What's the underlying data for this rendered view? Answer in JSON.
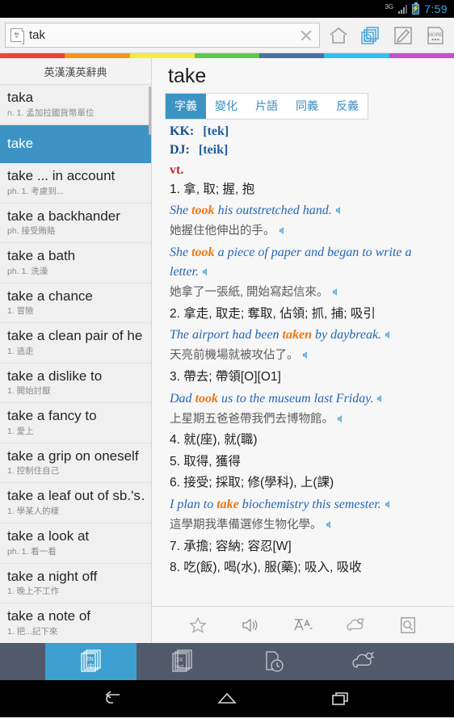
{
  "status_bar": {
    "network": "3G",
    "time": "7:59",
    "time_color": "#38a8dd",
    "battery_icon": "battery-charging-icon",
    "signal_icon": "signal-bars-icon"
  },
  "toolbar": {
    "search": {
      "value": "tak",
      "placeholder": "",
      "icon": "dictionary-book-icon",
      "clear_icon": "clear-x-icon"
    },
    "actions": [
      {
        "name": "home-button",
        "icon": "home-icon",
        "label": "Home",
        "active": false
      },
      {
        "name": "media-cards-button",
        "icon": "media-stack-icon",
        "label": "Media",
        "active": true
      },
      {
        "name": "notes-button",
        "icon": "pencil-edit-icon",
        "label": "Notes",
        "active": false
      },
      {
        "name": "more-button",
        "icon": "more-page-icon",
        "label": "MORE",
        "active": false
      }
    ]
  },
  "rainbow_colors": [
    "#ef4136",
    "#f7941e",
    "#f6ec3c",
    "#5cc94c",
    "#4a6fa5",
    "#31c0ef",
    "#c44fd0"
  ],
  "sidebar": {
    "title": "英漢漢英辭典",
    "entries": [
      {
        "headword": "taka",
        "sub": "n. 1. 孟加拉國貨幣單位",
        "selected": false
      },
      {
        "headword": "take",
        "sub": "",
        "selected": true
      },
      {
        "headword": "take ... in account",
        "sub": "ph. 1. 考慮到...",
        "selected": false
      },
      {
        "headword": "take a backhander",
        "sub": "ph. 接受賄賂",
        "selected": false
      },
      {
        "headword": "take a bath",
        "sub": "ph. 1. 洗澡",
        "selected": false
      },
      {
        "headword": "take a chance",
        "sub": "1. 冒險",
        "selected": false
      },
      {
        "headword": "take a clean pair of he…",
        "sub": "1. 逃走",
        "selected": false
      },
      {
        "headword": "take a dislike to",
        "sub": "1. 開始討厭",
        "selected": false
      },
      {
        "headword": "take a fancy to",
        "sub": "1. 愛上",
        "selected": false
      },
      {
        "headword": "take a grip on oneself",
        "sub": "1. 控制住自己",
        "selected": false
      },
      {
        "headword": "take a leaf out of sb.'s…",
        "sub": "1. 學某人的樣",
        "selected": false
      },
      {
        "headword": "take a look at",
        "sub": "ph. 1. 看一看",
        "selected": false
      },
      {
        "headword": "take a night off",
        "sub": "1. 晚上不工作",
        "selected": false
      },
      {
        "headword": "take a note of",
        "sub": "1. 把...記下來",
        "selected": false
      }
    ],
    "selected_color": "#3d94c4"
  },
  "entry": {
    "title": "take",
    "tabs": [
      {
        "label": "字義",
        "active": true
      },
      {
        "label": "變化",
        "active": false
      },
      {
        "label": "片語",
        "active": false
      },
      {
        "label": "同義",
        "active": false
      },
      {
        "label": "反義",
        "active": false
      }
    ],
    "pronunciations": [
      {
        "system": "KK:",
        "value": "[tek]"
      },
      {
        "system": "DJ:",
        "value": "[teik]"
      }
    ],
    "part_of_speech": "vt.",
    "senses": [
      {
        "number": "1.",
        "gloss": "拿, 取; 握, 抱",
        "examples": [
          {
            "pre": "She ",
            "hl": "took",
            "post": " his outstretched hand.",
            "zh": "她握住他伸出的手。"
          },
          {
            "pre": "She ",
            "hl": "took",
            "post": " a piece of paper and began to write a letter.",
            "zh": "她拿了一張紙, 開始寫起信來。"
          }
        ]
      },
      {
        "number": "2.",
        "gloss": "拿走, 取走; 奪取, 佔領; 抓, 捕; 吸引",
        "examples": [
          {
            "pre": "The airport had been ",
            "hl": "taken",
            "post": " by daybreak.",
            "zh": "天亮前機場就被攻佔了。"
          }
        ]
      },
      {
        "number": "3.",
        "gloss": "帶去; 帶領[O][O1]",
        "examples": [
          {
            "pre": "Dad ",
            "hl": "took",
            "post": " us to the museum last Friday.",
            "zh": "上星期五爸爸帶我們去博物館。"
          }
        ]
      },
      {
        "number": "4.",
        "gloss": "就(座), 就(職)",
        "examples": []
      },
      {
        "number": "5.",
        "gloss": "取得, 獲得",
        "examples": []
      },
      {
        "number": "6.",
        "gloss": "接受; 採取; 修(學科), 上(課)",
        "examples": [
          {
            "pre": "I plan to ",
            "hl": "take",
            "post": " biochemistry this semester.",
            "zh": "這學期我準備選修生物化學。"
          }
        ]
      },
      {
        "number": "7.",
        "gloss": "承擔; 容納; 容忍[W]",
        "examples": []
      },
      {
        "number": "8.",
        "gloss": "吃(飯), 喝(水), 服(藥); 吸入, 吸收",
        "examples": []
      }
    ]
  },
  "action_bar": [
    {
      "name": "favorite-button",
      "icon": "star-icon"
    },
    {
      "name": "pronounce-button",
      "icon": "speaker-icon"
    },
    {
      "name": "font-size-button",
      "icon": "font-size-icon"
    },
    {
      "name": "cloud-sync-button",
      "icon": "cloud-icon"
    },
    {
      "name": "search-in-page-button",
      "icon": "magnifier-page-icon"
    }
  ],
  "bottom_nav": [
    {
      "name": "nav-en-zh-dictionary",
      "icon": "en-zh-book-icon",
      "label_top": "EN",
      "label_bottom": "中",
      "active": true
    },
    {
      "name": "nav-oxford-dictionary",
      "icon": "oxford-book-icon",
      "label_top": "OX",
      "label_bottom": "ford",
      "active": false
    },
    {
      "name": "nav-history",
      "icon": "history-clock-icon",
      "label_top": "",
      "label_bottom": "",
      "active": false
    },
    {
      "name": "nav-cloud",
      "icon": "cloud-nav-icon",
      "label_top": "",
      "label_bottom": "",
      "active": false
    }
  ],
  "android_nav": [
    {
      "name": "android-back-button",
      "icon": "back-arrow-icon"
    },
    {
      "name": "android-home-button",
      "icon": "home-pentagon-icon"
    },
    {
      "name": "android-recents-button",
      "icon": "recents-square-icon"
    }
  ]
}
